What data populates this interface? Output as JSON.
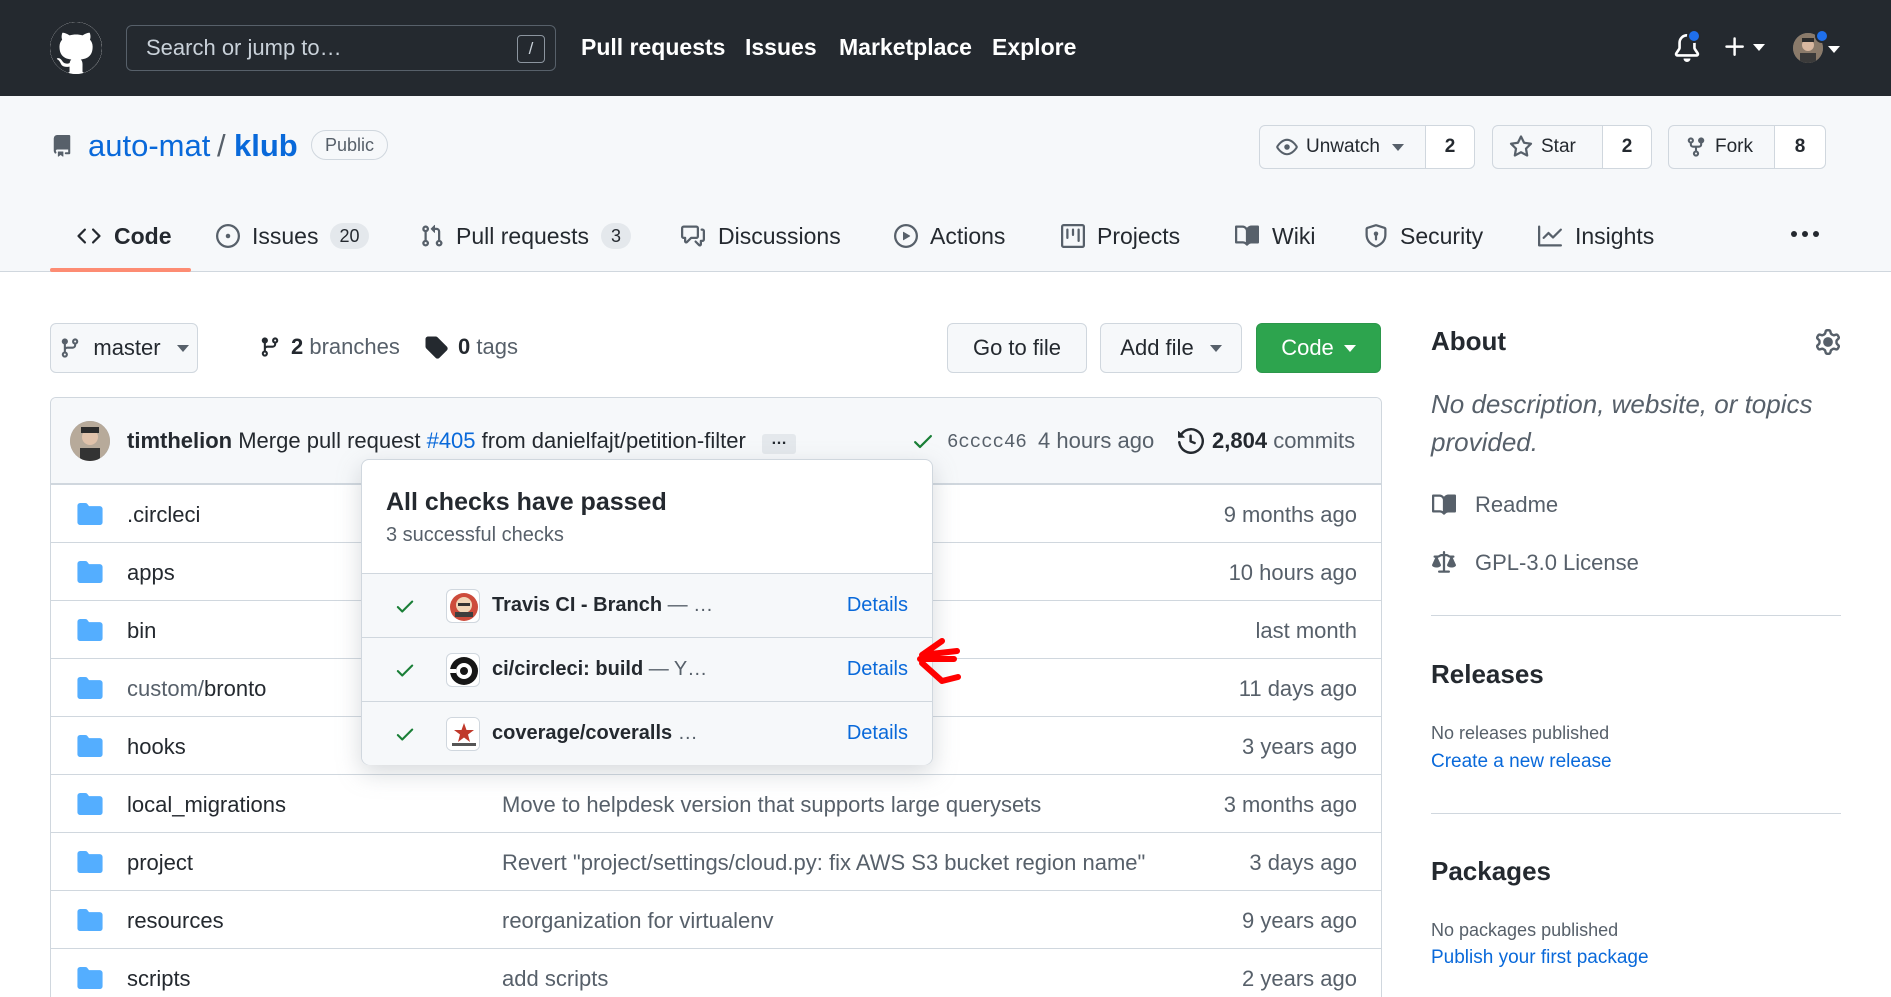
{
  "header": {
    "search_placeholder": "Search or jump to…",
    "search_key": "/",
    "nav": [
      "Pull requests",
      "Issues",
      "Marketplace",
      "Explore"
    ]
  },
  "repo": {
    "owner": "auto-mat",
    "separator": "/",
    "name": "klub",
    "visibility": "Public",
    "watch": {
      "label": "Unwatch",
      "count": "2"
    },
    "star": {
      "label": "Star",
      "count": "2"
    },
    "fork": {
      "label": "Fork",
      "count": "8"
    }
  },
  "tabs": [
    {
      "label": "Code"
    },
    {
      "label": "Issues",
      "count": "20"
    },
    {
      "label": "Pull requests",
      "count": "3"
    },
    {
      "label": "Discussions"
    },
    {
      "label": "Actions"
    },
    {
      "label": "Projects"
    },
    {
      "label": "Wiki"
    },
    {
      "label": "Security"
    },
    {
      "label": "Insights"
    }
  ],
  "toolbar": {
    "branch": "master",
    "branches_count": "2",
    "branches_label": "branches",
    "tags_count": "0",
    "tags_label": "tags",
    "go_to_file": "Go to file",
    "add_file": "Add file",
    "code": "Code"
  },
  "commit": {
    "author": "timthelion",
    "message_prefix": "Merge pull request",
    "pr": "#405",
    "message_suffix": "from danielfajt/petition-filter",
    "ellipsis": "…",
    "sha": "6cccc46",
    "time": "4 hours ago",
    "count": "2,804",
    "count_label": "commits"
  },
  "files": [
    {
      "prefix": "",
      "name": ".circleci",
      "message": "",
      "age": "9 months ago"
    },
    {
      "prefix": "",
      "name": "apps",
      "message": "",
      "age": "10 hours ago"
    },
    {
      "prefix": "",
      "name": "bin",
      "message": "",
      "age": "last month"
    },
    {
      "prefix": "custom/",
      "name": "bronto",
      "message": "",
      "age": "11 days ago"
    },
    {
      "prefix": "",
      "name": "hooks",
      "message": "",
      "age": "3 years ago"
    },
    {
      "prefix": "",
      "name": "local_migrations",
      "message": "Move to helpdesk version that supports large querysets",
      "age": "3 months ago"
    },
    {
      "prefix": "",
      "name": "project",
      "message": "Revert \"project/settings/cloud.py: fix AWS S3 bucket region name\"",
      "age": "3 days ago"
    },
    {
      "prefix": "",
      "name": "resources",
      "message": "reorganization for virtualenv",
      "age": "9 years ago"
    },
    {
      "prefix": "",
      "name": "scripts",
      "message": "add scripts",
      "age": "2 years ago"
    }
  ],
  "checks_popover": {
    "title": "All checks have passed",
    "subtitle": "3 successful checks",
    "checks": [
      {
        "name": "Travis CI - Branch",
        "desc": "— …",
        "details": "Details",
        "icon": "travis-ci-icon"
      },
      {
        "name": "ci/circleci: build",
        "desc": "— Y…",
        "details": "Details",
        "icon": "circleci-icon"
      },
      {
        "name": "coverage/coveralls",
        "desc": "…",
        "details": "Details",
        "icon": "coveralls-icon"
      }
    ]
  },
  "sidebar": {
    "about_title": "About",
    "about_text": "No description, website, or topics provided.",
    "readme": "Readme",
    "license": "GPL-3.0 License",
    "releases_title": "Releases",
    "releases_none": "No releases published",
    "releases_link": "Create a new release",
    "packages_title": "Packages",
    "packages_none": "No packages published",
    "packages_link": "Publish your first package"
  },
  "colors": {
    "header_bg": "#24292f",
    "link": "#0969da",
    "success": "#2da44e",
    "folder": "#54aeff",
    "tab_underline": "#fd8c73",
    "annotation": "#ff0000"
  }
}
